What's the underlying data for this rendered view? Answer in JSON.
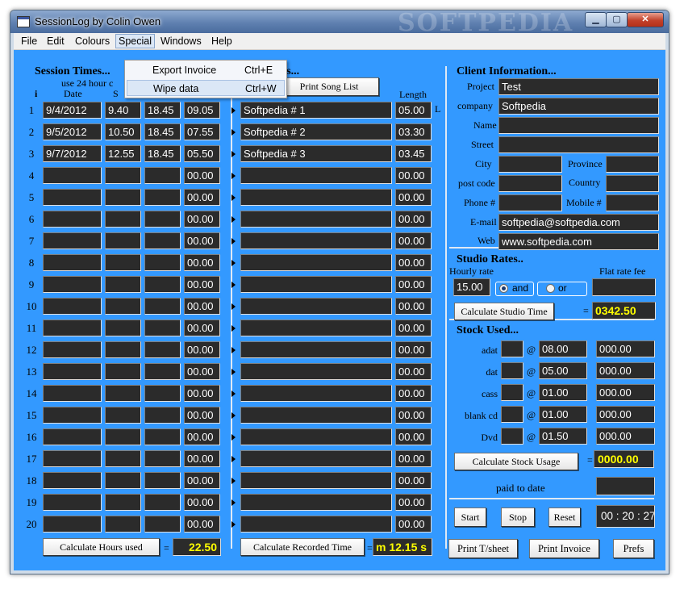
{
  "window": {
    "title": "SessionLog by Colin Owen",
    "watermark": "SOFTPEDIA",
    "min_glyph": "▁",
    "max_glyph": "▢",
    "close_glyph": "✕"
  },
  "menu": [
    "File",
    "Edit",
    "Colours",
    "Special",
    "Windows",
    "Help"
  ],
  "special_menu": [
    {
      "label": "Export Invoice",
      "shortcut": "Ctrl+E"
    },
    {
      "label": "Wipe data",
      "shortcut": "Ctrl+W"
    }
  ],
  "session": {
    "heading": "Session Times...",
    "hint": "use 24 hour c",
    "col_i": "i",
    "col_date": "Date",
    "col_s": "S",
    "rows": [
      {
        "n": "1",
        "date": "9/4/2012",
        "start": "9.40",
        "end": "18.45",
        "hours": "09.05"
      },
      {
        "n": "2",
        "date": "9/5/2012",
        "start": "10.50",
        "end": "18.45",
        "hours": "07.55"
      },
      {
        "n": "3",
        "date": "9/7/2012",
        "start": "12.55",
        "end": "18.45",
        "hours": "05.50"
      },
      {
        "n": "4",
        "date": "",
        "start": "",
        "end": "",
        "hours": "00.00"
      },
      {
        "n": "5",
        "date": "",
        "start": "",
        "end": "",
        "hours": "00.00"
      },
      {
        "n": "6",
        "date": "",
        "start": "",
        "end": "",
        "hours": "00.00"
      },
      {
        "n": "7",
        "date": "",
        "start": "",
        "end": "",
        "hours": "00.00"
      },
      {
        "n": "8",
        "date": "",
        "start": "",
        "end": "",
        "hours": "00.00"
      },
      {
        "n": "9",
        "date": "",
        "start": "",
        "end": "",
        "hours": "00.00"
      },
      {
        "n": "10",
        "date": "",
        "start": "",
        "end": "",
        "hours": "00.00"
      },
      {
        "n": "11",
        "date": "",
        "start": "",
        "end": "",
        "hours": "00.00"
      },
      {
        "n": "12",
        "date": "",
        "start": "",
        "end": "",
        "hours": "00.00"
      },
      {
        "n": "13",
        "date": "",
        "start": "",
        "end": "",
        "hours": "00.00"
      },
      {
        "n": "14",
        "date": "",
        "start": "",
        "end": "",
        "hours": "00.00"
      },
      {
        "n": "15",
        "date": "",
        "start": "",
        "end": "",
        "hours": "00.00"
      },
      {
        "n": "16",
        "date": "",
        "start": "",
        "end": "",
        "hours": "00.00"
      },
      {
        "n": "17",
        "date": "",
        "start": "",
        "end": "",
        "hours": "00.00"
      },
      {
        "n": "18",
        "date": "",
        "start": "",
        "end": "",
        "hours": "00.00"
      },
      {
        "n": "19",
        "date": "",
        "start": "",
        "end": "",
        "hours": "00.00"
      },
      {
        "n": "20",
        "date": "",
        "start": "",
        "end": "",
        "hours": "00.00"
      }
    ],
    "calc_button": "Calculate Hours used",
    "equals": "=",
    "total": "22.50"
  },
  "songs": {
    "heading_partial": "es...",
    "print_button": "Print Song List",
    "col_length": "Length",
    "col_l": "L",
    "rows": [
      {
        "title": "Softpedia # 1",
        "length": "05.00"
      },
      {
        "title": "Softpedia # 2",
        "length": "03.30"
      },
      {
        "title": "Softpedia # 3",
        "length": "03.45"
      },
      {
        "title": "",
        "length": "00.00"
      },
      {
        "title": "",
        "length": "00.00"
      },
      {
        "title": "",
        "length": "00.00"
      },
      {
        "title": "",
        "length": "00.00"
      },
      {
        "title": "",
        "length": "00.00"
      },
      {
        "title": "",
        "length": "00.00"
      },
      {
        "title": "",
        "length": "00.00"
      },
      {
        "title": "",
        "length": "00.00"
      },
      {
        "title": "",
        "length": "00.00"
      },
      {
        "title": "",
        "length": "00.00"
      },
      {
        "title": "",
        "length": "00.00"
      },
      {
        "title": "",
        "length": "00.00"
      },
      {
        "title": "",
        "length": "00.00"
      },
      {
        "title": "",
        "length": "00.00"
      },
      {
        "title": "",
        "length": "00.00"
      },
      {
        "title": "",
        "length": "00.00"
      },
      {
        "title": "",
        "length": "00.00"
      }
    ],
    "calc_button": "Calculate Recorded Time",
    "equals": "=",
    "total": "m 12.15 s"
  },
  "client": {
    "heading": "Client Information...",
    "project_label": "Project",
    "project": "Test",
    "company_label": "company",
    "company": "Softpedia",
    "name_label": "Name",
    "name": "",
    "street_label": "Street",
    "street": "",
    "city_label": "City",
    "city": "",
    "province_label": "Province",
    "province": "",
    "postcode_label": "post code",
    "postcode": "",
    "country_label": "Country",
    "country": "",
    "phone_label": "Phone #",
    "phone": "",
    "mobile_label": "Mobile #",
    "mobile": "",
    "email_label": "E-mail",
    "email": "softpedia@softpedia.com",
    "web_label": "Web",
    "web": "www.softpedia.com"
  },
  "rates": {
    "heading": "Studio Rates..",
    "hourly_label": "Hourly rate",
    "hourly": "15.00",
    "flat_label": "Flat rate fee",
    "flat": "",
    "and_label": "and",
    "or_label": "or",
    "calc_button": "Calculate Studio Time",
    "equals": "=",
    "total": "0342.50"
  },
  "stock": {
    "heading": "Stock Used...",
    "at": "@",
    "items": [
      {
        "label": "adat",
        "qty": "",
        "price": "08.00",
        "total": "000.00"
      },
      {
        "label": "dat",
        "qty": "",
        "price": "05.00",
        "total": "000.00"
      },
      {
        "label": "cass",
        "qty": "",
        "price": "01.00",
        "total": "000.00"
      },
      {
        "label": "blank cd",
        "qty": "",
        "price": "01.00",
        "total": "000.00"
      },
      {
        "label": "Dvd",
        "qty": "",
        "price": "01.50",
        "total": "000.00"
      }
    ],
    "calc_button": "Calculate Stock Usage",
    "equals": "=",
    "total": "0000.00",
    "paid_label": "paid to date",
    "paid": ""
  },
  "timer": {
    "start": "Start",
    "stop": "Stop",
    "reset": "Reset",
    "display": "00 : 20 : 27"
  },
  "bottom": {
    "print_tsheet": "Print T/sheet",
    "print_invoice": "Print Invoice",
    "prefs": "Prefs"
  }
}
